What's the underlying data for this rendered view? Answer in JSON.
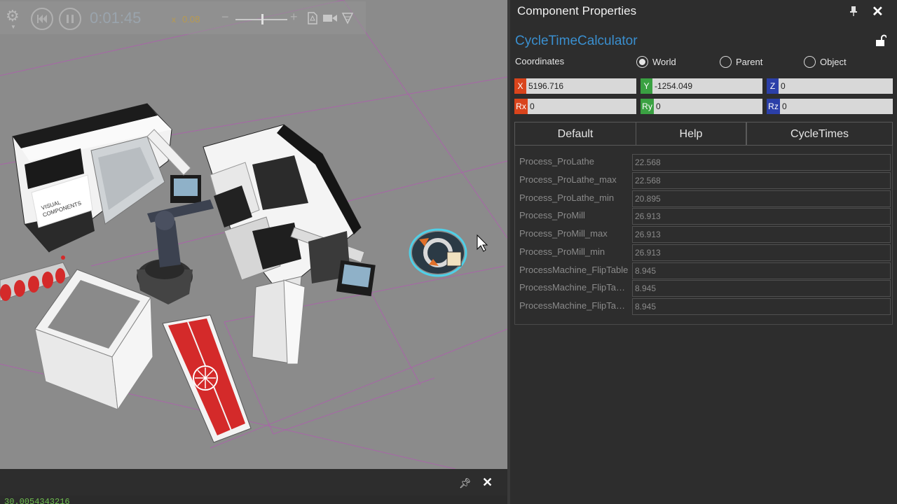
{
  "toolbar": {
    "time": "0:01:45",
    "speed_prefix": "x",
    "speed": "0.08"
  },
  "scene": {
    "brand_line1": "VISUAL",
    "brand_line2": "COMPONENTS"
  },
  "output": {
    "text": "30.0054343216"
  },
  "panel": {
    "title": "Component Properties",
    "component_name": "CycleTimeCalculator",
    "coordinates_label": "Coordinates",
    "radio": {
      "world": "World",
      "parent": "Parent",
      "object": "Object",
      "selected": "World"
    },
    "coords": {
      "x_label": "X",
      "x": "5196.716",
      "y_label": "Y",
      "y": "-1254.049",
      "z_label": "Z",
      "z": "0",
      "rx_label": "Rx",
      "rx": "0",
      "ry_label": "Ry",
      "ry": "0",
      "rz_label": "Rz",
      "rz": "0"
    },
    "tabs": [
      "Default",
      "Help",
      "CycleTimes"
    ],
    "active_tab": "CycleTimes",
    "properties": [
      {
        "label": "Process_ProLathe",
        "value": "22.568"
      },
      {
        "label": "Process_ProLathe_max",
        "value": "22.568"
      },
      {
        "label": "Process_ProLathe_min",
        "value": "20.895"
      },
      {
        "label": "Process_ProMill",
        "value": "26.913"
      },
      {
        "label": "Process_ProMill_max",
        "value": "26.913"
      },
      {
        "label": "Process_ProMill_min",
        "value": "26.913"
      },
      {
        "label": "ProcessMachine_FlipTable",
        "value": "8.945"
      },
      {
        "label": "ProcessMachine_FlipTabl...",
        "value": "8.945"
      },
      {
        "label": "ProcessMachine_FlipTabl...",
        "value": "8.945"
      }
    ]
  },
  "colors": {
    "accent": "#3a8fcf",
    "x_axis": "#d9441c",
    "y_axis": "#3aa142",
    "z_axis": "#2b3fa8",
    "conveyor_belt": "#d42a2a",
    "viewport_bg": "#8b8b8b"
  }
}
